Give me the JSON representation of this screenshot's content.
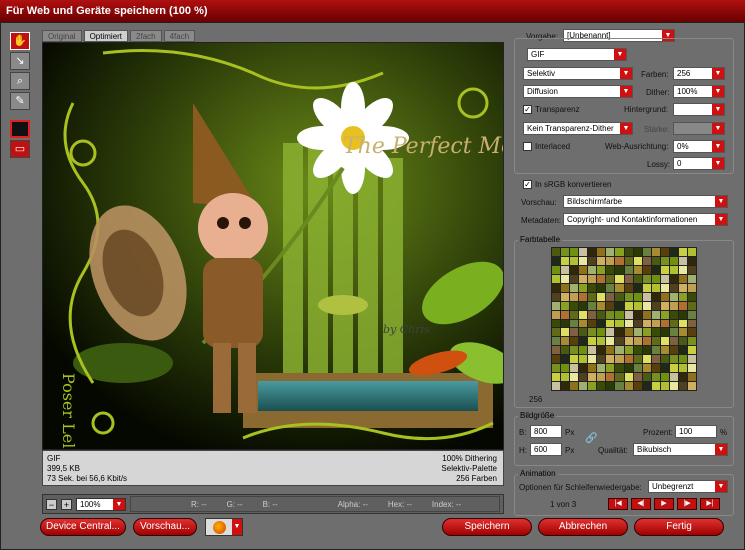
{
  "window": {
    "title": "Für Web und Geräte speichern (100 %)"
  },
  "tabs": [
    "Original",
    "Optimiert",
    "2fach",
    "4fach"
  ],
  "active_tab": 1,
  "tools": [
    {
      "name": "hand-tool-icon",
      "glyph": "✋"
    },
    {
      "name": "slice-select-icon",
      "glyph": "↘"
    },
    {
      "name": "zoom-icon",
      "glyph": "🔍"
    },
    {
      "name": "eyedropper-icon",
      "glyph": "✎"
    }
  ],
  "canvas_text": {
    "watermark_top": "The Perfect Moment",
    "watermark_side": "Poser Lell",
    "signature": "by Chris"
  },
  "info": {
    "format": "GIF",
    "size": "399,5 KB",
    "time": "73 Sek. bei 56,6 Kbit/s",
    "dither": "100% Dithering",
    "palette": "Selektiv-Palette",
    "colors": "256 Farben"
  },
  "status": {
    "zoom": "100%",
    "r": "R: --",
    "g": "G: --",
    "b": "B: --",
    "alpha": "Alpha: --",
    "hex": "Hex: --",
    "index": "Index: --"
  },
  "buttons": {
    "device_central": "Device Central...",
    "preview": "Vorschau...",
    "save": "Speichern",
    "cancel": "Abbrechen",
    "done": "Fertig"
  },
  "settings": {
    "preset_label": "Vorgabe:",
    "preset": "[Unbenannt]",
    "format": "GIF",
    "reduction": "Selektiv",
    "colors_label": "Farben:",
    "colors": "256",
    "dither_algo": "Diffusion",
    "dither_label": "Dither:",
    "dither": "100%",
    "transparency_label": "Transparenz",
    "transparency_checked": true,
    "matte_label": "Hintergrund:",
    "transp_dither": "Kein Transparenz-Dither",
    "amount_label": "Stärke:",
    "interlaced_label": "Interlaced",
    "interlaced_checked": false,
    "websnap_label": "Web-Ausrichtung:",
    "websnap": "0%",
    "lossy_label": "Lossy:",
    "lossy": "0",
    "srgb_label": "In sRGB konvertieren",
    "srgb_checked": true,
    "preview_label": "Vorschau:",
    "preview": "Bildschirmfarbe",
    "metadata_label": "Metadaten:",
    "metadata": "Copyright- und Kontaktinformationen"
  },
  "color_table": {
    "title": "Farbtabelle",
    "count": "256",
    "palette": [
      "#4a5a10",
      "#8aa020",
      "#c8d040",
      "#606a18",
      "#302808",
      "#a88a30",
      "#d0b060",
      "#789020",
      "#3a4a08",
      "#b0c030",
      "#e0e060",
      "#907018",
      "#58400c",
      "#c0a050",
      "#robust",
      "#2a3a04"
    ]
  },
  "image_size": {
    "title": "Bildgröße",
    "w_label": "B:",
    "w": "800",
    "h_label": "H:",
    "h": "600",
    "unit": "Px",
    "percent_label": "Prozent:",
    "percent": "100",
    "percent_unit": "%",
    "quality_label": "Qualität:",
    "quality": "Bikubisch"
  },
  "animation": {
    "title": "Animation",
    "loop_label": "Optionen für Schleifenwiedergabe:",
    "loop": "Unbegrenzt",
    "frame": "1 von 3"
  },
  "colors": {
    "accent": "#d01010",
    "panel": "#6e6e6e"
  }
}
